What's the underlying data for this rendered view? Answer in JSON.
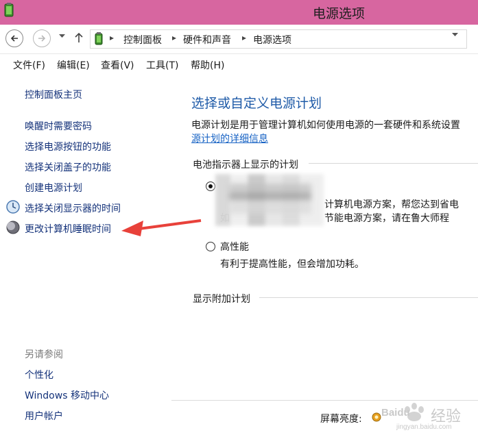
{
  "window": {
    "title": "电源选项"
  },
  "address": {
    "crumbs": [
      "控制面板",
      "硬件和声音",
      "电源选项"
    ]
  },
  "menu": [
    "文件(F)",
    "编辑(E)",
    "查看(V)",
    "工具(T)",
    "帮助(H)"
  ],
  "sidebar": {
    "home": "控制面板主页",
    "links": [
      "唤醒时需要密码",
      "选择电源按钮的功能",
      "选择关闭盖子的功能",
      "创建电源计划",
      "选择关闭显示器的时间",
      "更改计算机睡眠时间"
    ],
    "see_also_title": "另请参阅",
    "see_also": [
      "个性化",
      "Windows 移动中心",
      "用户帐户"
    ]
  },
  "main": {
    "heading": "选择或自定义电源计划",
    "description": "电源计划是用于管理计算机如何使用电源的一套硬件和系统设置",
    "details_link": "源计划的详细信息",
    "battery_group": "电池指示器上显示的计划",
    "plan1_line1": "计算机电源方案，帮您达到省电",
    "plan1_line2_prefix": "如",
    "plan1_line2": "节能电源方案，请在鲁大师程",
    "plan2_name": "高性能",
    "plan2_desc": "有利于提高性能，但会增加功耗。",
    "additional_group": "显示附加计划",
    "brightness_label": "屏幕亮度:"
  },
  "watermark": {
    "brand": "Baidu",
    "text": "经验",
    "url": "jingyan.baidu.com"
  },
  "colors": {
    "titlebar": "#d766a0",
    "link": "#14327a",
    "heading": "#1f5ba8",
    "annotation_arrow": "#e8413a"
  }
}
